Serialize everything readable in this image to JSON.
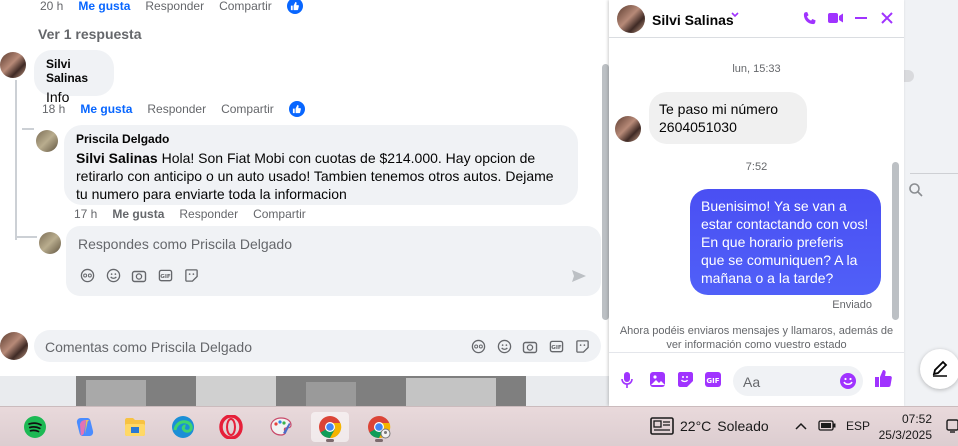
{
  "post": {
    "top_actions": {
      "time": "20 h",
      "like": "Me gusta",
      "reply": "Responder",
      "share": "Compartir"
    },
    "view_replies": "Ver 1 respuesta",
    "comment1": {
      "author": "Silvi Salinas",
      "text": "Info",
      "time": "18 h",
      "like": "Me gusta",
      "reply": "Responder",
      "share": "Compartir"
    },
    "comment2": {
      "author": "Priscila Delgado",
      "mention": "Silvi Salinas",
      "text": " Hola! Son Fiat Mobi con cuotas de $214.000. Hay opcion de retirarlo con anticipo o un auto usado! Tambien tenemos otros autos. Dejame tu numero para enviarte toda la informacion",
      "time": "17 h",
      "like": "Me gusta",
      "reply": "Responder",
      "share": "Compartir"
    },
    "reply_placeholder": "Respondes como Priscila Delgado",
    "comment_placeholder": "Comentas como Priscila Delgado"
  },
  "chat": {
    "contact_name": "Silvi Salinas",
    "timestamp1": "lun, 15:33",
    "incoming_message": "Te paso mi número 2604051030",
    "timestamp2": "7:52",
    "outgoing_message": "Buenisimo! Ya se van a estar contactando con vos! En que horario preferis que se comuniquen? A la mañana o a la tarde?",
    "status": "Enviado",
    "notice": "Ahora podéis enviaros mensajes y llamaros, además de ver información como vuestro estado",
    "input_placeholder": "Aa",
    "accent_color": "#a033ff",
    "bubble_color": "#4a55f6"
  },
  "taskbar": {
    "apps": [
      "spotify-icon",
      "copilot-icon",
      "file-explorer-icon",
      "edge-icon",
      "opera-icon",
      "paint-icon",
      "chrome-icon",
      "chrome-profile-icon"
    ],
    "weather_temp": "22°C",
    "weather_text": "Soleado",
    "language": "ESP",
    "time": "07:52",
    "date": "25/3/2025"
  }
}
